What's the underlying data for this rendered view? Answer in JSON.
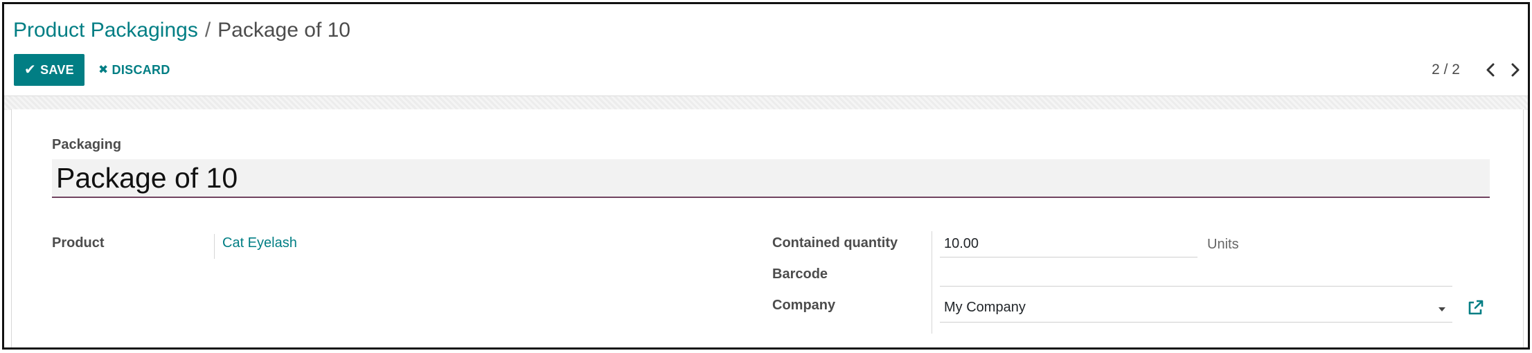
{
  "breadcrumb": {
    "parent": "Product Packagings",
    "separator": "/",
    "current": "Package of 10"
  },
  "toolbar": {
    "save_label": "SAVE",
    "discard_label": "DISCARD"
  },
  "pager": {
    "value": "2 / 2"
  },
  "form": {
    "packaging_label": "Packaging",
    "packaging_name": "Package of 10",
    "product_label": "Product",
    "product_value": "Cat Eyelash",
    "contained_quantity_label": "Contained quantity",
    "contained_quantity_value": "10.00",
    "contained_quantity_unit": "Units",
    "barcode_label": "Barcode",
    "barcode_value": "",
    "company_label": "Company",
    "company_value": "My Company"
  },
  "colors": {
    "accent": "#017e84",
    "name_underline": "#71435f"
  },
  "icons": {
    "save": "check-icon",
    "discard": "close-icon",
    "prev": "chevron-left-icon",
    "next": "chevron-right-icon",
    "company_dropdown": "caret-down-icon",
    "company_external": "external-link-icon"
  }
}
